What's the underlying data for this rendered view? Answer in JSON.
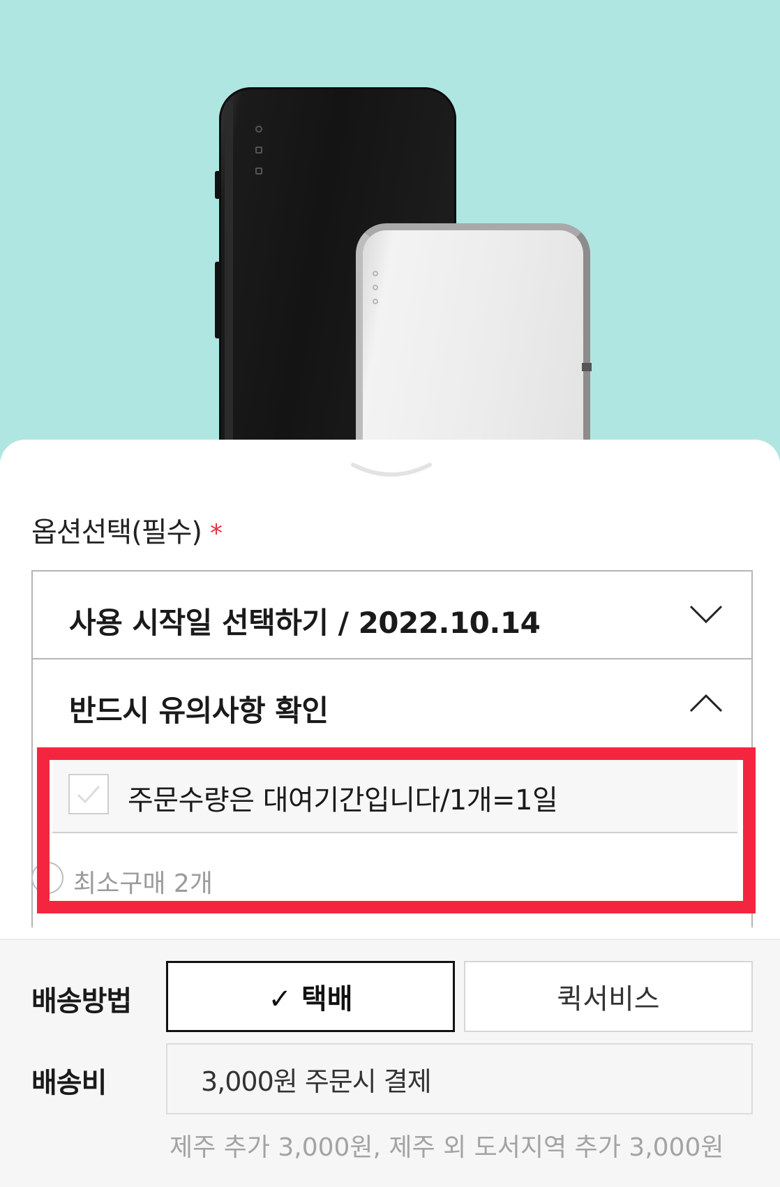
{
  "hero": {
    "image_alt": "pocket-wifi-devices"
  },
  "options": {
    "title": "옵션선택(필수)",
    "required_mark": "*",
    "start_date_select": {
      "label": "사용 시작일 선택하기 / 2022.10.14"
    },
    "notice_select": {
      "label": "반드시 유의사항 확인"
    },
    "notice_item": {
      "text": "주문수량은 대여기간입니다/1개=1일",
      "checked": false
    },
    "min_purchase": "최소구매 2개"
  },
  "delivery": {
    "method_label": "배송방법",
    "methods": [
      {
        "label": "✓ 택배",
        "selected": true
      },
      {
        "label": "퀵서비스",
        "selected": false
      }
    ],
    "fee_label": "배송비",
    "fee_value": "3,000원 주문시 결제",
    "extra_note": "제주 추가 3,000원, 제주 외 도서지역 추가 3,000원"
  },
  "colors": {
    "hero_bg": "#b0e6e2",
    "required": "#e8323c",
    "highlight": "#f4263f"
  }
}
